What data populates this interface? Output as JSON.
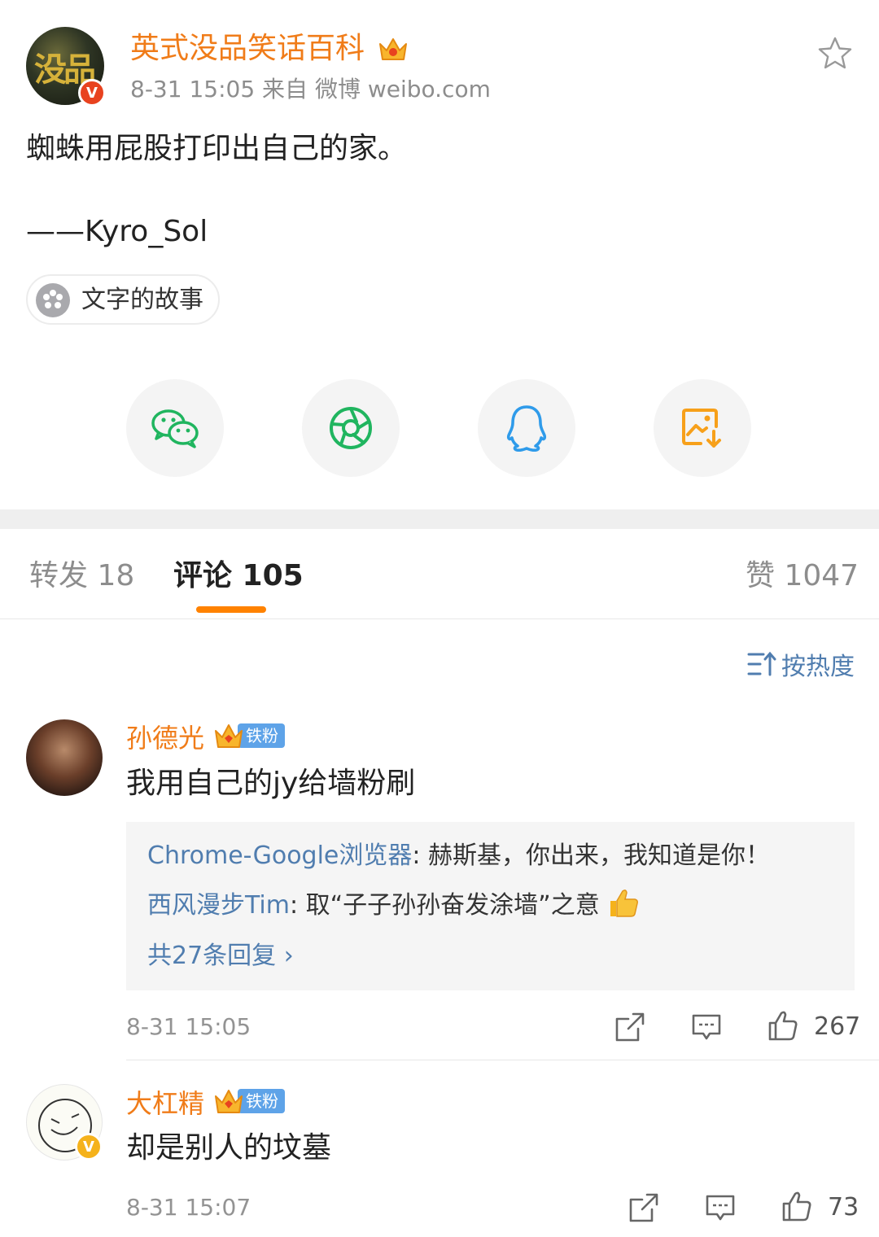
{
  "post": {
    "author": "英式没品笑话百科",
    "meta": "8-31 15:05  来自 微博 weibo.com",
    "text": "蜘蛛用屁股打印出自己的家。",
    "signature": "——Kyro_Sol",
    "avatar_text": "没品",
    "verified_mark": "V",
    "topic": "文字的故事"
  },
  "share_targets": [
    "wechat-icon",
    "moments-icon",
    "qq-icon",
    "save-image-icon"
  ],
  "tabs": {
    "repost": "转发 18",
    "comments": "评论 105",
    "likes": "赞 1047"
  },
  "sort": {
    "label": "按热度"
  },
  "comments": [
    {
      "name": "孙德光",
      "badge": "铁粉",
      "text": "我用自己的jy给墙粉刷",
      "replies": [
        {
          "user": "Chrome-Google浏览器",
          "text": ": 赫斯基，你出来，我知道是你！"
        },
        {
          "user": "西风漫步Tim",
          "text": ": 取“子子孙孙奋发涂墙”之意"
        }
      ],
      "more_replies": "共27条回复 ›",
      "time": "8-31 15:05",
      "likes": "267"
    },
    {
      "name": "大杠精",
      "badge": "铁粉",
      "verified_mark": "V",
      "text": "却是别人的坟墓",
      "time": "8-31 15:07",
      "likes": "73"
    }
  ],
  "colors": {
    "accent": "#ff8200",
    "username": "#f07c19",
    "link": "#507daf",
    "wechat": "#20b55f",
    "qq": "#2f9bea",
    "save": "#f7a01a"
  }
}
